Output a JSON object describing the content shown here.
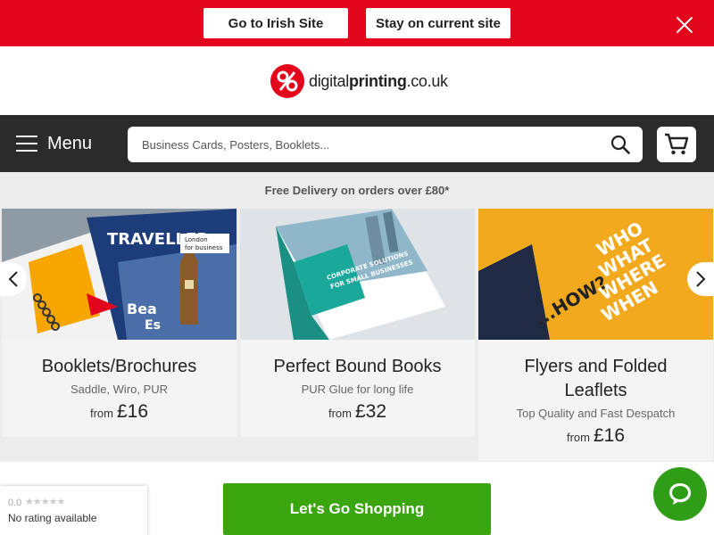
{
  "country_banner": {
    "go_irish_label": "Go to Irish Site",
    "stay_label": "Stay on current site",
    "close_icon": "close-icon",
    "background_color": "#e3051b"
  },
  "logo": {
    "text_prefix": "digital",
    "text_bold": "printing",
    "text_suffix": ".co.uk",
    "icon": "percent-logo-icon"
  },
  "navbar": {
    "menu_label": "Menu",
    "search_placeholder": "Business Cards, Posters, Booklets...",
    "search_icon": "search-icon",
    "cart_icon": "cart-icon"
  },
  "promo": {
    "text": "Free Delivery on orders over £80*"
  },
  "products": [
    {
      "title": "Booklets/Brochures",
      "subtitle": "Saddle, Wiro, PUR",
      "from_label": "from",
      "price": "£16"
    },
    {
      "title": "Perfect Bound Books",
      "subtitle": "PUR Glue for long life",
      "from_label": "from",
      "price": "£32"
    },
    {
      "title": "Flyers and Folded Leaflets",
      "subtitle": "Top Quality and Fast Despatch",
      "from_label": "from",
      "price": "£16"
    }
  ],
  "product_images": {
    "card1": {
      "text1": "TRAVELLER",
      "text2": "London",
      "text3": "for business",
      "text4": "Bea",
      "text5": "Es"
    },
    "card2": {
      "text1": "CORPORATE SOLUTIONS",
      "text2": "FOR SMALL BUSINESSES"
    },
    "card3": {
      "text1": "WHO",
      "text2": "WHAT",
      "text3": "WHERE",
      "text4": "WHEN",
      "text5": "...HOW?"
    }
  },
  "carousel": {
    "prev_icon": "chevron-left-icon",
    "next_icon": "chevron-right-icon"
  },
  "cta": {
    "shop_label": "Let's Go Shopping"
  },
  "rating_widget": {
    "score": "0.0",
    "stars": "★★★★★",
    "text": "No rating available"
  },
  "chat": {
    "icon": "chat-bubble-icon",
    "color": "#2f9e16"
  }
}
